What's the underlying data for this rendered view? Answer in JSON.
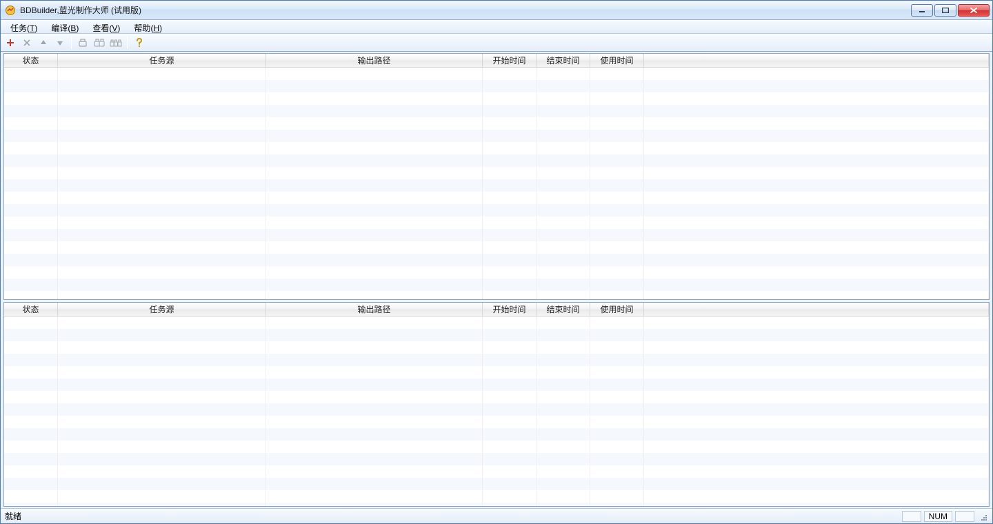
{
  "titlebar": {
    "title": "BDBuilder,蓝光制作大师 (试用版)"
  },
  "menu": {
    "task": {
      "label": "任务",
      "accel": "T"
    },
    "compile": {
      "label": "编译",
      "accel": "B"
    },
    "view": {
      "label": "查看",
      "accel": "V"
    },
    "help": {
      "label": "帮助",
      "accel": "H"
    }
  },
  "columns": {
    "status": "状态",
    "source": "任务源",
    "output": "输出路径",
    "start": "开始时间",
    "end": "结束时间",
    "elapsed": "使用时间"
  },
  "statusbar": {
    "ready": "就绪",
    "num": "NUM"
  }
}
